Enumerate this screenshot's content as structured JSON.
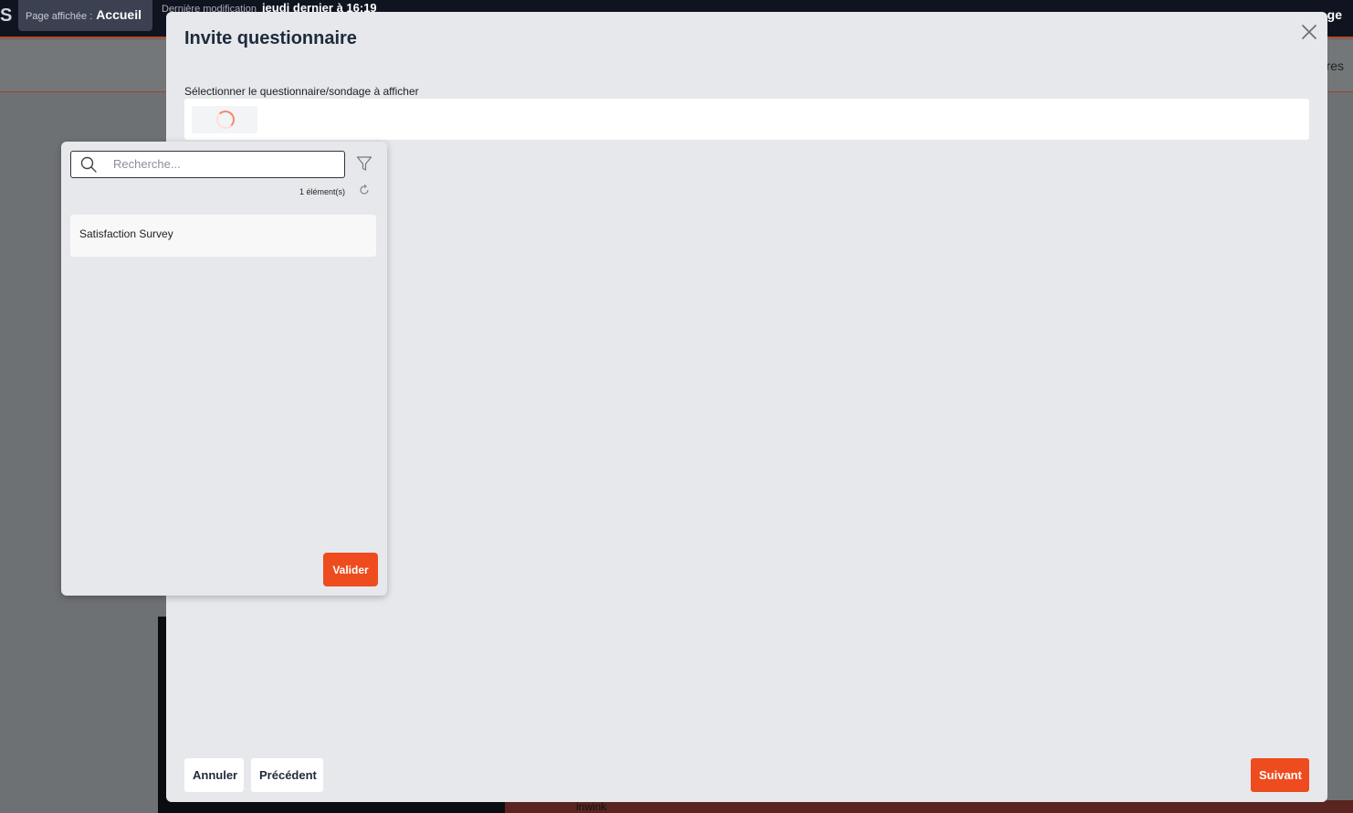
{
  "background": {
    "logo": "S",
    "page_label": "Page affichée :",
    "page_name": "Accueil",
    "last_mod_label": "Dernière modification",
    "last_mod_value": "jeudi dernier à 16:19",
    "topbar_right": "ge",
    "subbar_right": "res",
    "footer_brand": "inwink"
  },
  "modal": {
    "title": "Invite questionnaire",
    "field_label": "Sélectionner le questionnaire/sondage à afficher",
    "footer": {
      "cancel_label": "Annuler",
      "previous_label": "Précédent",
      "next_label": "Suivant"
    }
  },
  "dropdown": {
    "search_placeholder": "Recherche...",
    "search_value": "",
    "count_text": "1 élément(s)",
    "items": [
      {
        "label": "Satisfaction Survey"
      }
    ],
    "validate_label": "Valider"
  },
  "colors": {
    "accent": "#ee4b1f",
    "modal_bg": "#e6e8ec",
    "title": "#1f2a3c"
  }
}
